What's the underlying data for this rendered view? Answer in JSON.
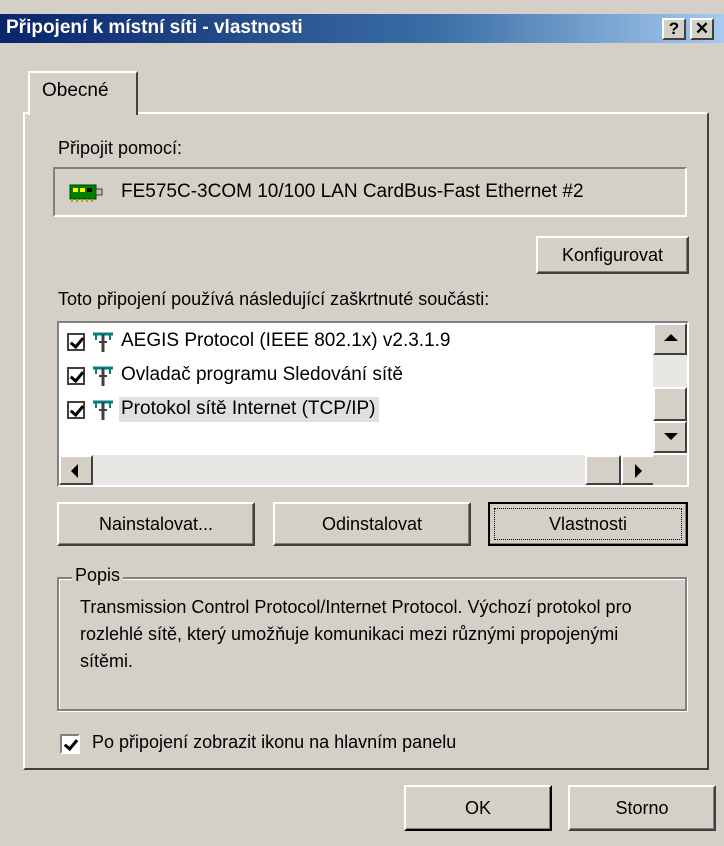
{
  "window": {
    "title": "Připojení k místní síti - vlastnosti",
    "help_button": "?",
    "close_button": "✕"
  },
  "tabs": [
    {
      "label": "Obecné"
    }
  ],
  "connect_using": {
    "label": "Připojit pomocí:",
    "adapter_name": "FE575C-3COM 10/100 LAN CardBus-Fast Ethernet #2",
    "adapter_icon": "network-card-icon",
    "configure_button": "Konfigurovat"
  },
  "components": {
    "label": "Toto připojení používá následující zaškrtnuté součásti:",
    "items": [
      {
        "label": "AEGIS Protocol (IEEE 802.1x) v2.3.1.9",
        "checked": true,
        "icon": "network-component-icon",
        "selected": false
      },
      {
        "label": "Ovladač programu Sledování sítě",
        "checked": true,
        "icon": "network-component-icon",
        "selected": false
      },
      {
        "label": "Protokol sítě Internet (TCP/IP)",
        "checked": true,
        "icon": "network-component-icon",
        "selected": true
      }
    ]
  },
  "buttons": {
    "install": "Nainstalovat...",
    "uninstall": "Odinstalovat",
    "properties": "Vlastnosti",
    "ok": "OK",
    "cancel": "Storno"
  },
  "description": {
    "legend": "Popis",
    "text": "Transmission Control Protocol/Internet Protocol. Výchozí protokol pro rozlehlé sítě, který umožňuje komunikaci mezi různými propojenými sítěmi."
  },
  "show_icon_option": {
    "label": "Po připojení zobrazit ikonu na hlavním panelu",
    "checked": true
  }
}
